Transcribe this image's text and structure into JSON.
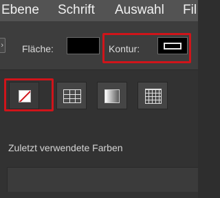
{
  "menu": {
    "items": [
      "Ebene",
      "Schrift",
      "Auswahl",
      "Fil"
    ]
  },
  "options_bar": {
    "edge_glyph": "›",
    "fill_label": "Fläche:",
    "fill_color": "#000000",
    "stroke_label": "Kontur:",
    "stroke_color": "#000000",
    "highlight_color": "#d0141a"
  },
  "swatch_panel": {
    "modes": [
      {
        "name": "none",
        "icon": "none-swatch-icon"
      },
      {
        "name": "color-groups",
        "icon": "grid-icon"
      },
      {
        "name": "gradient",
        "icon": "gradient-icon"
      },
      {
        "name": "pattern",
        "icon": "pattern-icon"
      }
    ],
    "recent_colors_label": "Zuletzt verwendete Farben"
  }
}
